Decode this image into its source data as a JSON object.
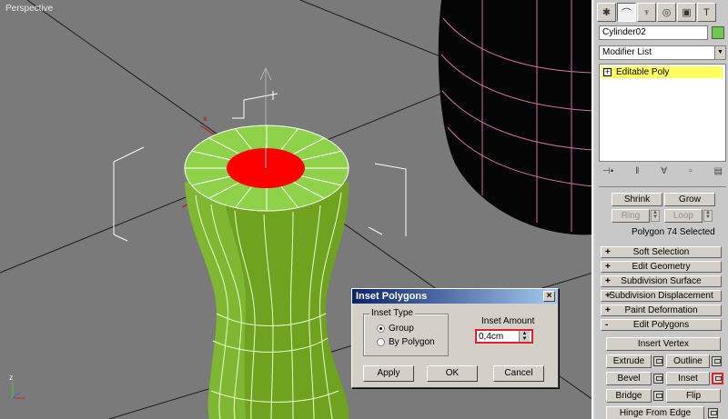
{
  "viewport": {
    "label": "Perspective",
    "colors": {
      "background": "#7a7a7a",
      "cylinder": "#6fa21f",
      "cap": "#8ed24a",
      "selected": "#ff0000",
      "wire": "#ffffff",
      "dark_object": "#050505",
      "dark_wire": "#d070a0"
    }
  },
  "dialog": {
    "title": "Inset Polygons",
    "close": "×",
    "inset_type_label": "Inset Type",
    "options": [
      "Group",
      "By Polygon"
    ],
    "selected_option": "Group",
    "inset_amount_label": "Inset Amount",
    "inset_amount_value": "0,4cm",
    "buttons": {
      "apply": "Apply",
      "ok": "OK",
      "cancel": "Cancel"
    }
  },
  "panel": {
    "toolbar_icons": [
      "create-icon",
      "modify-icon",
      "hierarchy-icon",
      "motion-icon",
      "display-icon",
      "utilities-icon"
    ],
    "object_name": "Cylinder02",
    "object_color": "#6ccb4a",
    "modifier_list": "Modifier List",
    "stack_items": [
      {
        "label": "Editable Poly",
        "expander": "+"
      }
    ],
    "selection": {
      "shrink": "Shrink",
      "grow": "Grow",
      "ring": "Ring",
      "loop": "Loop",
      "status": "Polygon 74 Selected"
    },
    "rollouts": [
      {
        "sign": "+",
        "label": "Soft Selection"
      },
      {
        "sign": "+",
        "label": "Edit Geometry"
      },
      {
        "sign": "+",
        "label": "Subdivision Surface"
      },
      {
        "sign": "+",
        "label": "Subdivision Displacement"
      },
      {
        "sign": "+",
        "label": "Paint Deformation"
      },
      {
        "sign": "-",
        "label": "Edit Polygons"
      }
    ],
    "edit_polygons": {
      "insert_vertex": "Insert Vertex",
      "extrude": "Extrude",
      "outline": "Outline",
      "bevel": "Bevel",
      "inset": "Inset",
      "bridge": "Bridge",
      "flip": "Flip",
      "hinge": "Hinge From Edge"
    }
  }
}
